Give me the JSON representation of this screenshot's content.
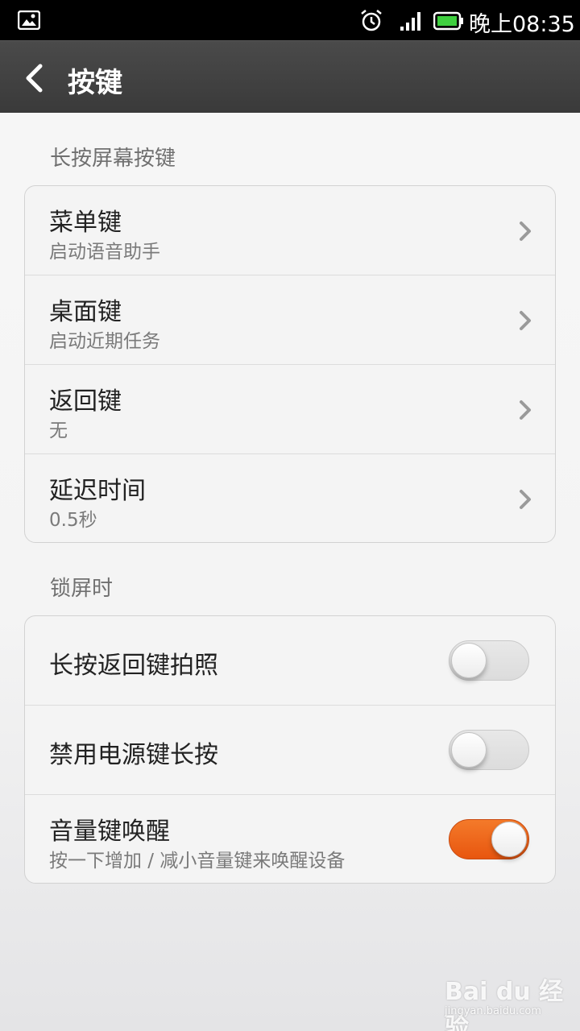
{
  "status_bar": {
    "time": "晚上08:35",
    "icons": [
      "gallery-icon",
      "alarm-icon",
      "signal-icon",
      "battery-icon"
    ],
    "battery_color": "#3fcf3f"
  },
  "action_bar": {
    "title": "按键"
  },
  "sections": [
    {
      "header": "长按屏幕按键",
      "items": [
        {
          "title": "菜单键",
          "subtitle": "启动语音助手"
        },
        {
          "title": "桌面键",
          "subtitle": "启动近期任务"
        },
        {
          "title": "返回键",
          "subtitle": "无"
        },
        {
          "title": "延迟时间",
          "subtitle": "0.5秒"
        }
      ]
    },
    {
      "header": "锁屏时",
      "items": [
        {
          "title": "长按返回键拍照",
          "toggle": false
        },
        {
          "title": "禁用电源键长按",
          "toggle": false
        },
        {
          "title": "音量键唤醒",
          "subtitle": "按一下增加 / 减小音量键来唤醒设备",
          "toggle": true
        }
      ]
    }
  ],
  "accent_color": "#f06a1c",
  "watermark": {
    "logo": "Bai du 经验",
    "url": "jingyan.baidu.com"
  }
}
